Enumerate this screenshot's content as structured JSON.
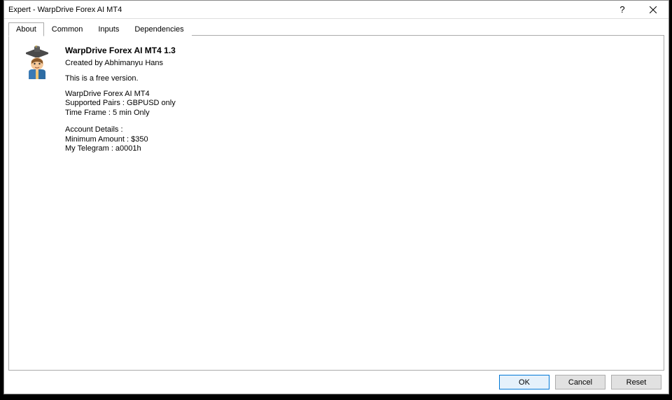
{
  "titlebar": {
    "title": "Expert - WarpDrive Forex AI MT4"
  },
  "tabs": {
    "about": "About",
    "common": "Common",
    "inputs": "Inputs",
    "dependencies": "Dependencies"
  },
  "about": {
    "heading": "WarpDrive Forex AI MT4 1.3",
    "created_by": "Created by Abhimanyu Hans",
    "free_version": "This is a free version.",
    "product_name": "WarpDrive Forex AI MT4",
    "supported_pairs": "Supported Pairs : GBPUSD only",
    "timeframe": "Time Frame : 5 min Only",
    "account_details_label": "Account Details :",
    "min_amount": "Minimum Amount : $350",
    "telegram": "My Telegram : a0001h"
  },
  "buttons": {
    "ok": "OK",
    "cancel": "Cancel",
    "reset": "Reset"
  }
}
